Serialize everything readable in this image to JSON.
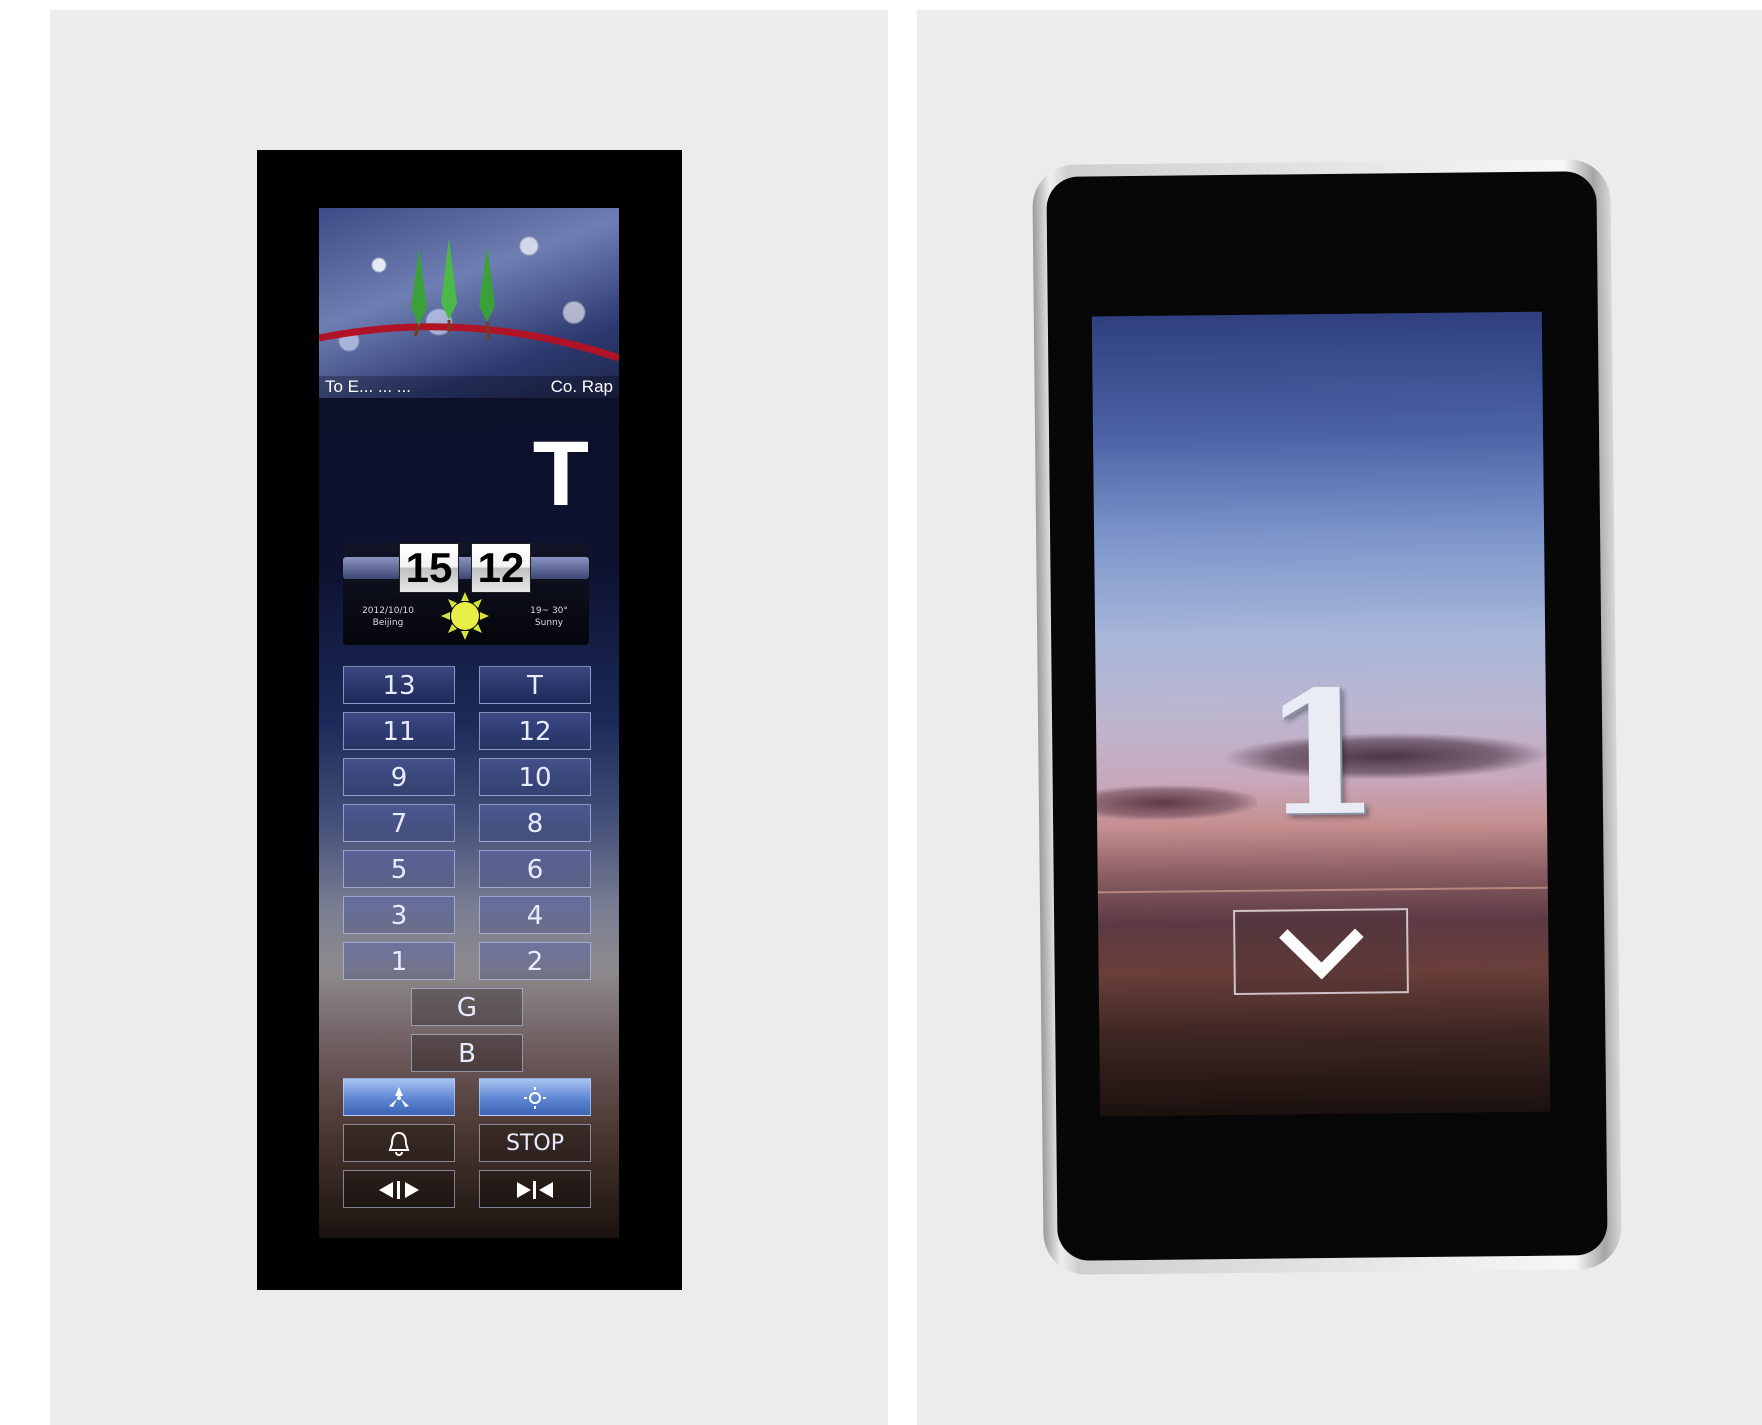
{
  "left_panel": {
    "ticker": {
      "left_text": "To E...  ...  ...",
      "right_text": "Co. Rap"
    },
    "floor_indicator": "T",
    "clock": {
      "hours": "15",
      "minutes": "12"
    },
    "weather": {
      "date": "2012/10/10",
      "date_sub": "Beijing",
      "temp": "19~ 30°",
      "temp_sub": "Sunny",
      "icon": "sun-icon"
    },
    "floor_buttons": [
      {
        "left": "13",
        "right": "T"
      },
      {
        "left": "11",
        "right": "12"
      },
      {
        "left": "9",
        "right": "10"
      },
      {
        "left": "7",
        "right": "8"
      },
      {
        "left": "5",
        "right": "6"
      },
      {
        "left": "3",
        "right": "4"
      },
      {
        "left": "1",
        "right": "2"
      }
    ],
    "center_buttons": [
      "G",
      "B"
    ],
    "controls": {
      "fan_icon": "fan-icon",
      "light_icon": "light-icon",
      "alarm_icon": "bell-icon",
      "stop_label": "STOP",
      "door_open_icon": "door-open-icon",
      "door_close_icon": "door-close-icon"
    },
    "colors": {
      "active_button": "#5e86d3",
      "frame": "#000000"
    }
  },
  "right_panel": {
    "floor_indicator": "1",
    "direction": "down",
    "direction_icon": "chevron-down-icon",
    "colors": {
      "frame": "#d9d9d9",
      "glass": "#070707"
    }
  }
}
